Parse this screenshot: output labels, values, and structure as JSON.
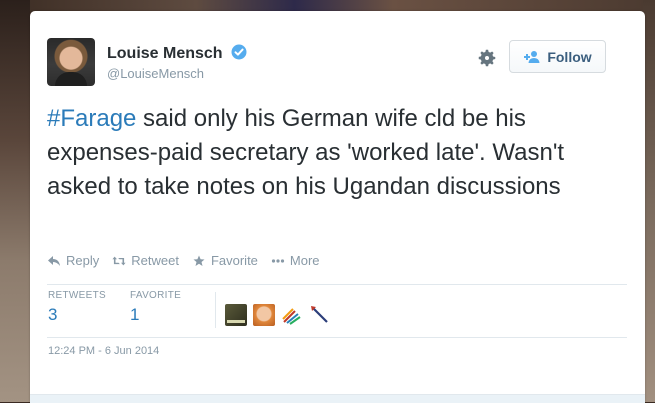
{
  "user": {
    "name": "Louise Mensch",
    "handle": "@LouiseMensch",
    "verified": true
  },
  "follow_button": {
    "label": "Follow"
  },
  "tweet": {
    "hashtag": "#Farage",
    "body": " said only his German wife cld be his expenses-paid secretary as 'worked late'. Wasn't asked to take notes on his Ugandan discussions"
  },
  "actions": {
    "reply": "Reply",
    "retweet": "Retweet",
    "favorite": "Favorite",
    "more": "More"
  },
  "stats": {
    "retweets_label": "RETWEETS",
    "retweets_count": "3",
    "favorites_label": "FAVORITE",
    "favorites_count": "1"
  },
  "timestamp": "12:24 PM - 6 Jun 2014",
  "colors": {
    "link": "#2b7bb9",
    "verified": "#55acee",
    "muted": "#8899a6",
    "text": "#292f33"
  },
  "icons": {
    "verified": "verified-badge-icon",
    "settings": "gear-icon",
    "follow": "person-plus-icon",
    "reply": "reply-arrow-icon",
    "retweet": "retweet-icon",
    "favorite": "star-icon",
    "more": "ellipsis-icon"
  }
}
